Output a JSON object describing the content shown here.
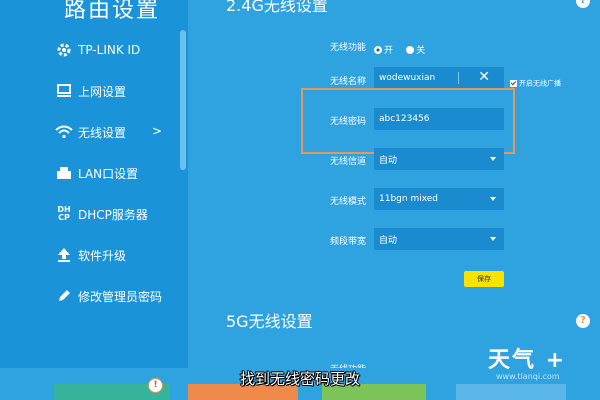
{
  "sidebar": {
    "title": "路由设置",
    "items": [
      {
        "label": "TP-LINK ID",
        "icon": "gear-icon"
      },
      {
        "label": "上网设置",
        "icon": "monitor-icon"
      },
      {
        "label": "无线设置",
        "icon": "wifi-icon",
        "arrow": ">"
      },
      {
        "label": "LAN口设置",
        "icon": "lan-port-icon"
      },
      {
        "label": "DHCP服务器",
        "icon": "dhcp-icon",
        "icon_text_top": "DH",
        "icon_text_bottom": "CP"
      },
      {
        "label": "软件升级",
        "icon": "upload-icon"
      },
      {
        "label": "修改管理员密码",
        "icon": "pencil-icon"
      }
    ]
  },
  "section_24g": {
    "title": "2.4G无线设置",
    "help": "?",
    "wireless_function": {
      "label": "无线功能",
      "on_label": "开",
      "off_label": "关",
      "selected": "开"
    },
    "ssid": {
      "label": "无线名称",
      "value": "wodewuxian",
      "clear": "✕",
      "broadcast_label": "开启无线广播",
      "broadcast_checked": true
    },
    "password": {
      "label": "无线密码",
      "value": "abc123456"
    },
    "channel": {
      "label": "无线信道",
      "value": "自动"
    },
    "mode": {
      "label": "无线模式",
      "value": "11bgn mixed"
    },
    "bandwidth": {
      "label": "频段带宽",
      "value": "自动"
    },
    "save_label": "保存"
  },
  "section_5g": {
    "title": "5G无线设置",
    "help": "?",
    "partial_label": "无线功能"
  },
  "caption": "找到无线密码更改",
  "watermark": {
    "title": "天气 +",
    "url": "www.tianqi.com"
  },
  "bottom_alert": "!",
  "colors": {
    "background": "#2fa2e0",
    "sidebar": "#1a93d8",
    "field": "#1b8bcf",
    "save": "#f7e200",
    "highlight": "#e8975a"
  }
}
